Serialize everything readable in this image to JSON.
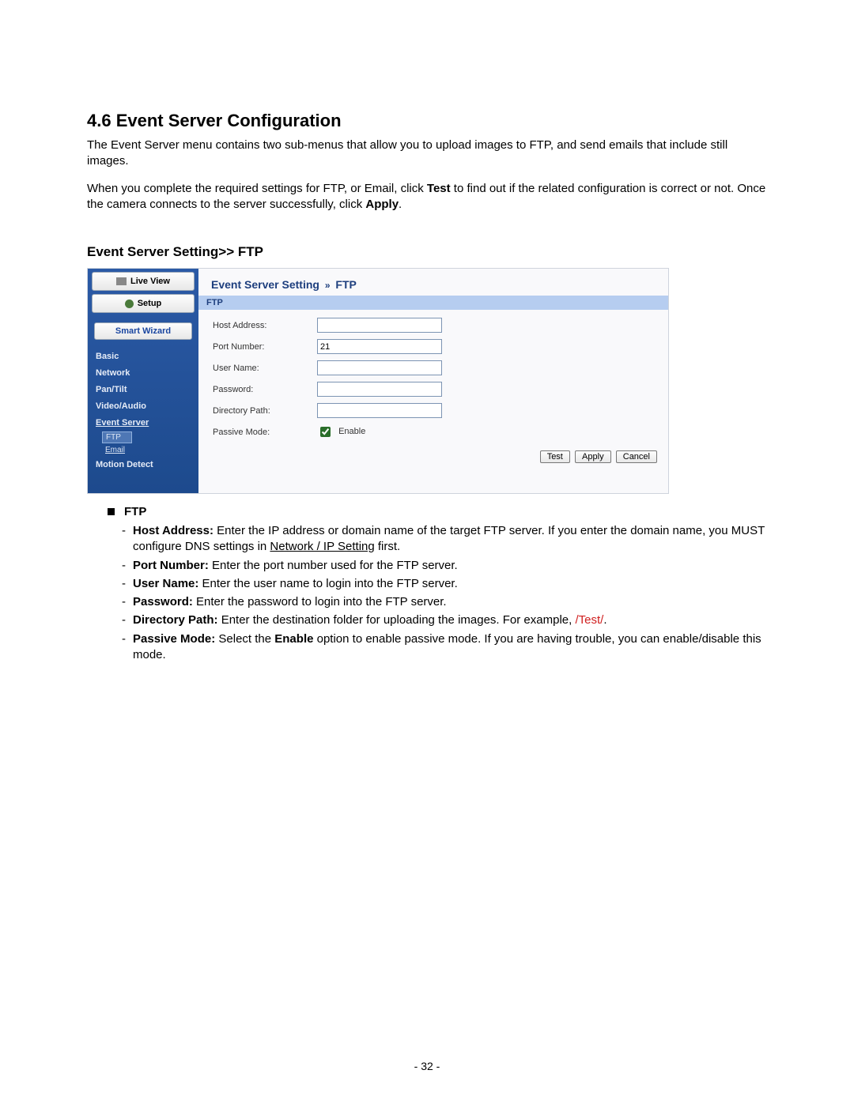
{
  "heading": "4.6  Event Server Configuration",
  "para1_a": "The Event Server menu contains two sub-menus that allow you to upload images to FTP, and send emails that include still images.",
  "para2_a": "When you complete the required settings for FTP, or Email, click ",
  "para2_b": "Test",
  "para2_c": " to find out if the related configuration is correct or not. Once the camera connects to the server successfully, click ",
  "para2_d": "Apply",
  "para2_e": ".",
  "sub_heading": "Event Server Setting>> FTP",
  "sidebar": {
    "live_view": "Live View",
    "setup": "Setup",
    "wizard": "Smart Wizard",
    "items": [
      "Basic",
      "Network",
      "Pan/Tilt",
      "Video/Audio",
      "Event Server",
      "Motion Detect"
    ],
    "subs": [
      "FTP",
      "Email"
    ]
  },
  "content_header": {
    "a": "Event Server Setting",
    "b": "FTP"
  },
  "section_bar": "FTP",
  "form": {
    "host_label": "Host Address:",
    "host_value": "",
    "port_label": "Port Number:",
    "port_value": "21",
    "user_label": "User Name:",
    "user_value": "",
    "pass_label": "Password:",
    "pass_value": "",
    "dir_label": "Directory Path:",
    "dir_value": "",
    "passive_label": "Passive Mode:",
    "enable_label": "Enable"
  },
  "buttons": {
    "test": "Test",
    "apply": "Apply",
    "cancel": "Cancel"
  },
  "desc": {
    "ftp_heading": "FTP",
    "host_a": "Host Address:",
    "host_b": " Enter the IP address or domain name of the target FTP server.  If you enter the domain name, you MUST configure DNS settings in ",
    "host_c": "Network / IP Setting",
    "host_d": " first.",
    "port_a": "Port Number:",
    "port_b": " Enter the port number used for the FTP server.",
    "user_a": "User Name:",
    "user_b": " Enter the user name to login into the FTP server.",
    "pass_a": "Password:",
    "pass_b": " Enter the password to login into the FTP server.",
    "dir_a": "Directory Path:",
    "dir_b": " Enter the destination folder for uploading the images. For example, ",
    "dir_c": "/Test/",
    "dir_d": ".",
    "pm_a": "Passive Mode:",
    "pm_b": " Select the ",
    "pm_c": "Enable",
    "pm_d": " option to enable passive mode.  If you are having trouble, you can enable/disable this mode."
  },
  "page_number": "- 32 -"
}
